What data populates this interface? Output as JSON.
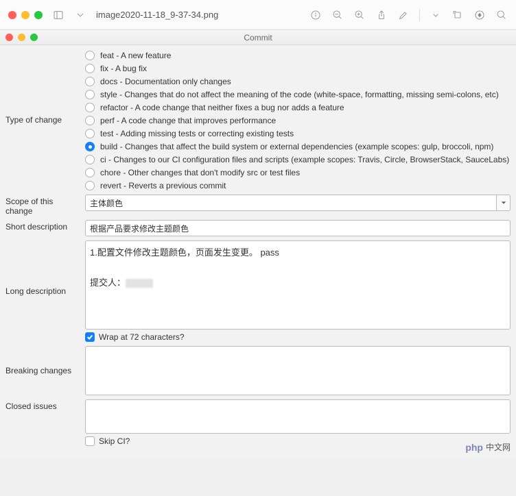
{
  "toolbar": {
    "filename": "image2020-11-18_9-37-34.png"
  },
  "window": {
    "title": "Commit"
  },
  "form": {
    "type_label": "Type of change",
    "scope_label": "Scope of this change",
    "short_label": "Short description",
    "long_label": "Long description",
    "breaking_label": "Breaking changes",
    "closed_label": "Closed issues",
    "types": [
      {
        "key": "feat",
        "label": "feat - A new feature",
        "checked": false
      },
      {
        "key": "fix",
        "label": "fix - A bug fix",
        "checked": false
      },
      {
        "key": "docs",
        "label": "docs - Documentation only changes",
        "checked": false
      },
      {
        "key": "style",
        "label": "style - Changes that do not affect the meaning of the code (white-space, formatting, missing semi-colons, etc)",
        "checked": false
      },
      {
        "key": "refactor",
        "label": "refactor - A code change that neither fixes a bug nor adds a feature",
        "checked": false
      },
      {
        "key": "perf",
        "label": "perf - A code change that improves performance",
        "checked": false
      },
      {
        "key": "test",
        "label": "test - Adding missing tests or correcting existing tests",
        "checked": false
      },
      {
        "key": "build",
        "label": "build - Changes that affect the build system or external dependencies (example scopes: gulp, broccoli, npm)",
        "checked": true
      },
      {
        "key": "ci",
        "label": "ci - Changes to our CI configuration files and scripts (example scopes: Travis, Circle, BrowserStack, SauceLabs)",
        "checked": false
      },
      {
        "key": "chore",
        "label": "chore - Other changes that don't modify src or test files",
        "checked": false
      },
      {
        "key": "revert",
        "label": "revert - Reverts a previous commit",
        "checked": false
      }
    ],
    "scope_value": "主体颜色",
    "short_value": "根据产品要求修改主题颜色",
    "long_line1": "1.配置文件修改主题颜色，页面发生变更。 pass",
    "long_line2_prefix": "提交人：",
    "wrap_label": "Wrap at 72 characters?",
    "wrap_checked": true,
    "breaking_value": "",
    "closed_value": "",
    "skip_label": "Skip CI?",
    "skip_checked": false
  },
  "watermark": {
    "brand": "php",
    "text": "中文网"
  }
}
